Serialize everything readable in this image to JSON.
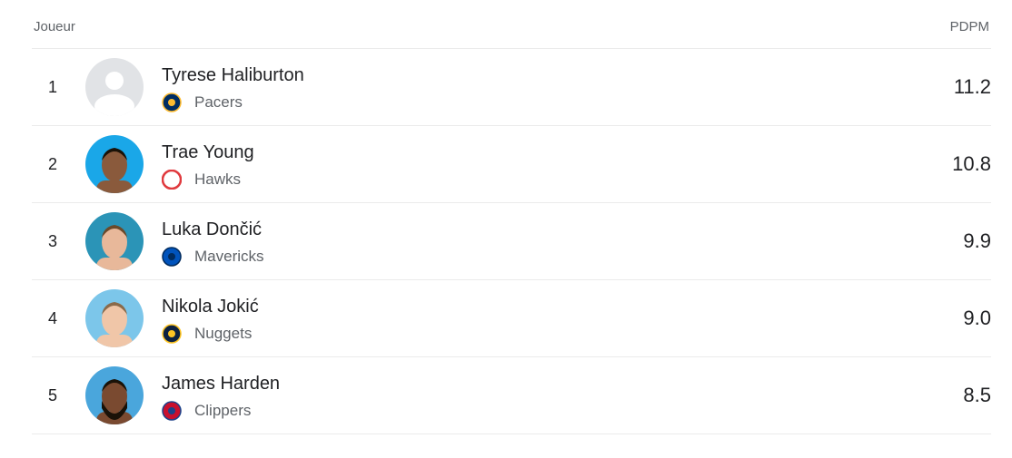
{
  "header": {
    "player_label": "Joueur",
    "stat_label": "PDPM"
  },
  "rows": [
    {
      "rank": "1",
      "name": "Tyrese Haliburton",
      "team": "Pacers",
      "value": "11.2",
      "avatar": "placeholder",
      "bg": "#e1e3e6",
      "logo_color": "#002d62",
      "logo_accent": "#fdbb30"
    },
    {
      "rank": "2",
      "name": "Trae Young",
      "team": "Hawks",
      "value": "10.8",
      "avatar": "photo",
      "bg": "#1aa7e8",
      "logo_color": "#e03a3e",
      "logo_accent": "#ffffff"
    },
    {
      "rank": "3",
      "name": "Luka Dončić",
      "team": "Mavericks",
      "value": "9.9",
      "avatar": "photo",
      "bg": "#2b94b7",
      "logo_color": "#0053bc",
      "logo_accent": "#002b5e"
    },
    {
      "rank": "4",
      "name": "Nikola Jokić",
      "team": "Nuggets",
      "value": "9.0",
      "avatar": "photo",
      "bg": "#7cc6ea",
      "logo_color": "#0e2240",
      "logo_accent": "#fec524"
    },
    {
      "rank": "5",
      "name": "James Harden",
      "team": "Clippers",
      "value": "8.5",
      "avatar": "photo",
      "bg": "#4aa6dc",
      "logo_color": "#c8102e",
      "logo_accent": "#1d428a"
    }
  ]
}
